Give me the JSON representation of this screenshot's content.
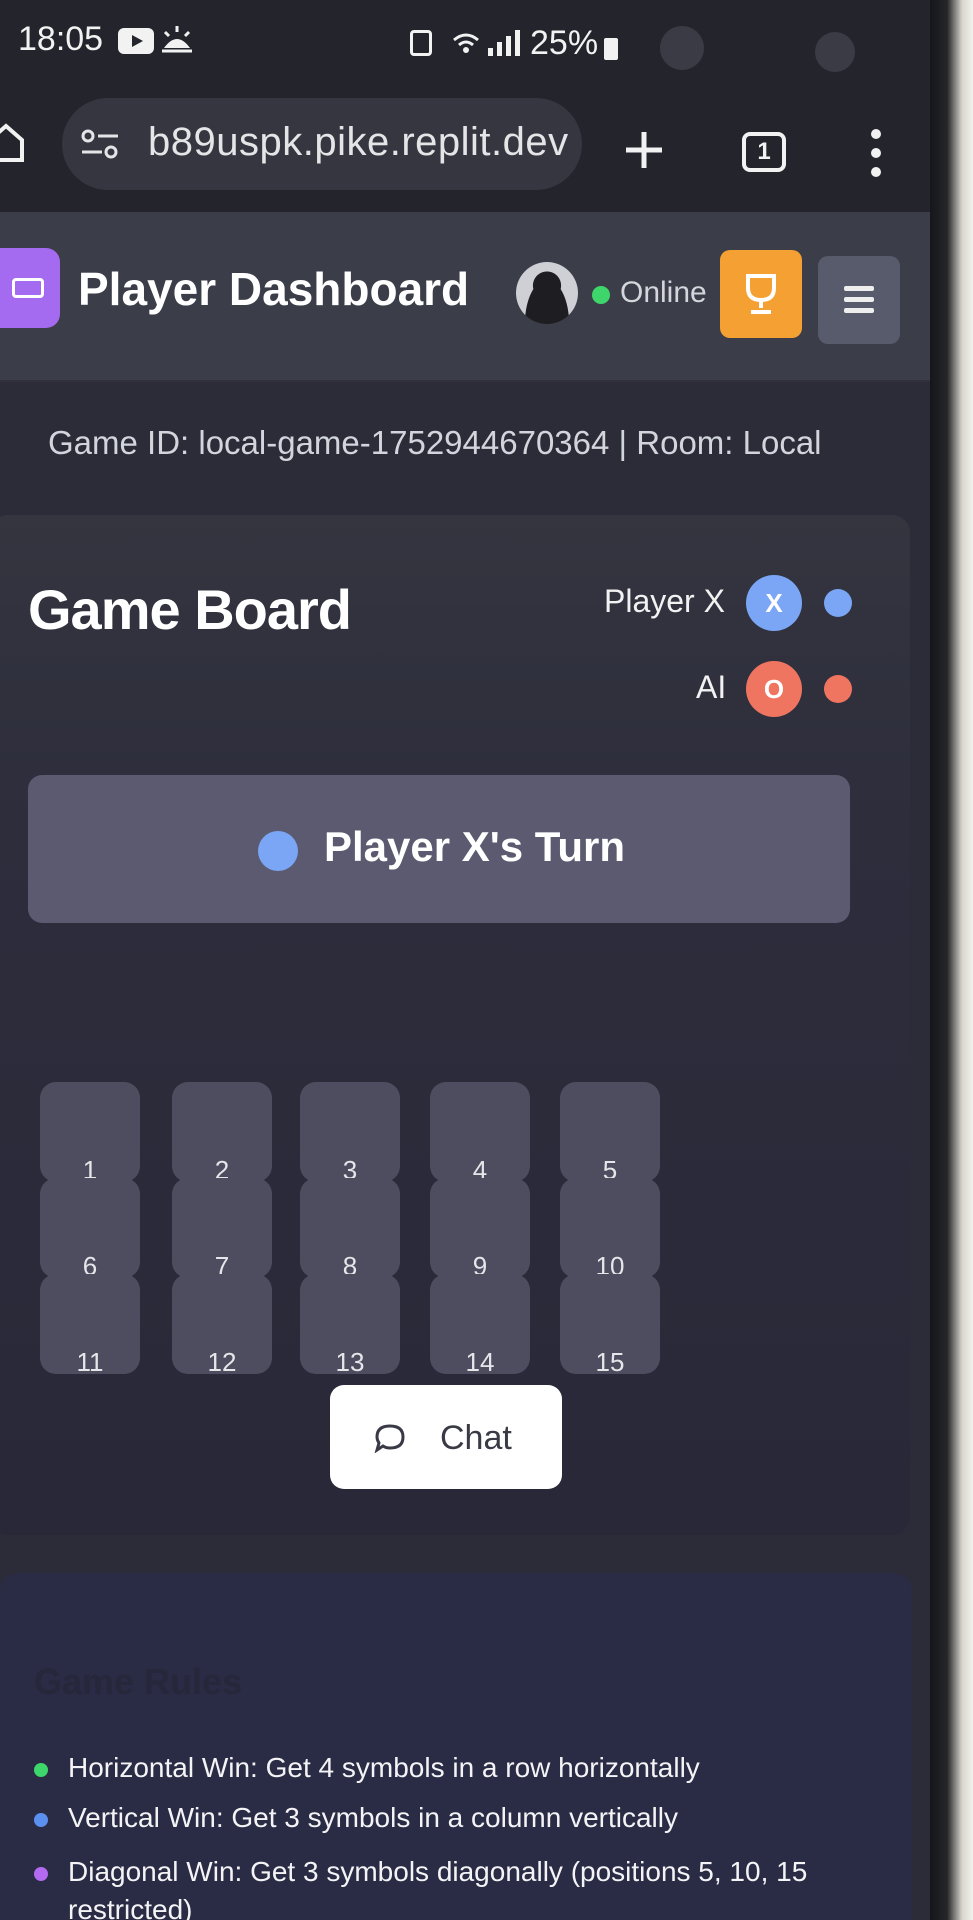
{
  "status_bar": {
    "time": "18:05",
    "battery": "25%"
  },
  "browser": {
    "url": "b89uspk.pike.replit.dev",
    "tab_count": "1"
  },
  "header": {
    "title": "Player Dashboard",
    "status": "Online"
  },
  "game_info": "Game ID: local-game-1752944670364 | Room: Local",
  "board": {
    "title": "Game Board",
    "players": [
      {
        "name": "Player X",
        "symbol": "X",
        "color": "#7aa6f5"
      },
      {
        "name": "AI",
        "symbol": "O",
        "color": "#f07560"
      }
    ],
    "turn_text": "Player X's Turn",
    "cells": [
      "1",
      "2",
      "3",
      "4",
      "5",
      "6",
      "7",
      "8",
      "9",
      "10",
      "11",
      "12",
      "13",
      "14",
      "15"
    ]
  },
  "chat_label": "Chat",
  "rules": {
    "title": "Game Rules",
    "items": [
      {
        "text": "Horizontal Win: Get 4 symbols in a row horizontally",
        "color": "#3ed66a"
      },
      {
        "text": "Vertical Win: Get 3 symbols in a column vertically",
        "color": "#5b8ff0"
      },
      {
        "text": "Diagonal Win: Get 3 symbols diagonally (positions 5, 10, 15 restricted)",
        "color": "#b46af0"
      }
    ]
  },
  "colors": {
    "accent_purple": "#a46af0",
    "trophy_orange": "#f5a032",
    "online_green": "#3ed66a"
  }
}
